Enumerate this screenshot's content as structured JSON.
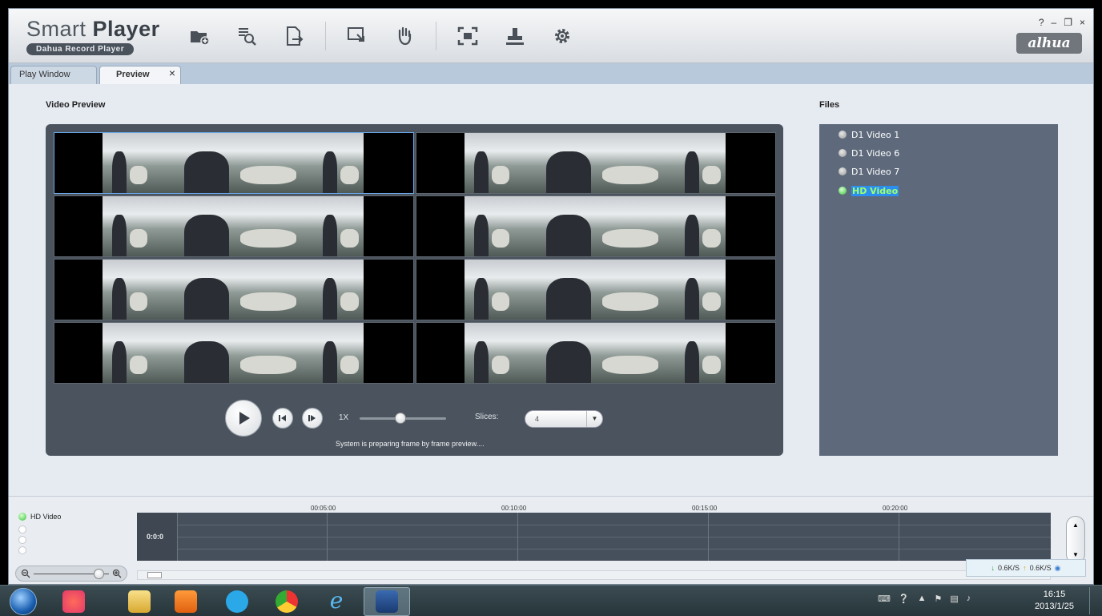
{
  "app": {
    "title_light": "Smart",
    "title_bold": "Player",
    "subtitle": "Dahua Record Player",
    "logo": "alhua",
    "window_controls": [
      "?",
      "–",
      "❐",
      "×"
    ]
  },
  "toolbar": {
    "icons": [
      "open-folder-icon",
      "search-file-icon",
      "export-file-icon",
      "snapshot-icon",
      "hand-icon",
      "fullscreen-icon",
      "stamp-icon",
      "settings-gear-icon"
    ]
  },
  "tabs": [
    {
      "label": "Play Window",
      "active": false
    },
    {
      "label": "Preview",
      "active": true,
      "close": "×"
    }
  ],
  "preview": {
    "section_title": "Video Preview",
    "speed_label": "1X",
    "speed_value": 0.45,
    "slices_label": "Slices:",
    "slices_value": "4",
    "status": "System is preparing frame by frame preview...."
  },
  "files": {
    "section_title": "Files",
    "items": [
      {
        "label": "D1 Video 1",
        "selected": false
      },
      {
        "label": "D1 Video 6",
        "selected": false
      },
      {
        "label": "D1 Video 7",
        "selected": false
      },
      {
        "label": "HD Video",
        "selected": true
      }
    ]
  },
  "timeline": {
    "file_label": "HD Video",
    "track_label": "0:0:0",
    "ticks": [
      "00:05:00",
      "00:10:00",
      "00:15:00",
      "00:20:00"
    ]
  },
  "status_bar": {
    "down_speed": "0.6K/S",
    "up_speed": "0.6K/S"
  },
  "taskbar": {
    "time": "16:15",
    "date": "2013/1/25",
    "colors": {
      "accent": "#2c8ff0",
      "active_file": "#9fff6a"
    }
  }
}
